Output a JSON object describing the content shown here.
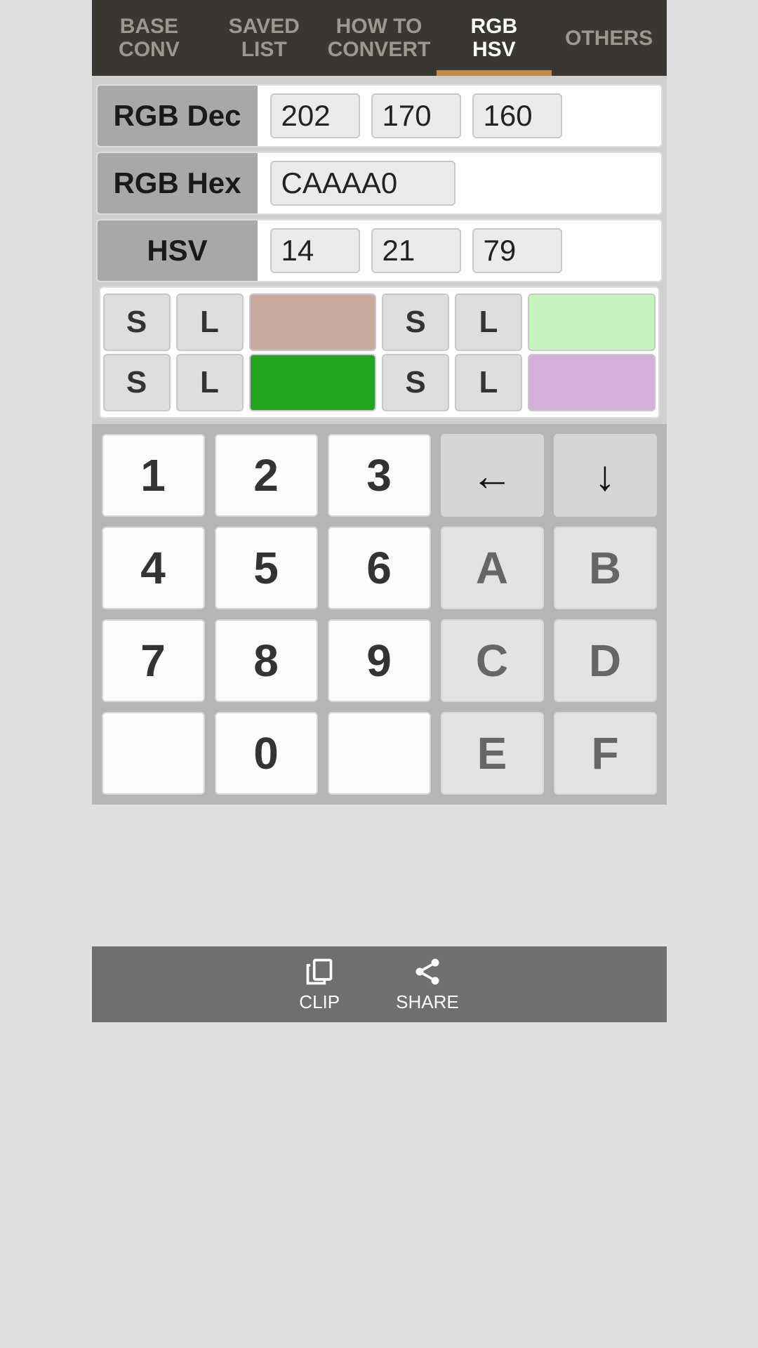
{
  "tabs": [
    {
      "label": "BASE\nCONV"
    },
    {
      "label": "SAVED\nLIST"
    },
    {
      "label": "HOW TO\nCONVERT"
    },
    {
      "label": "RGB\nHSV"
    },
    {
      "label": "OTHERS"
    }
  ],
  "rows": {
    "rgbDec": {
      "label": "RGB Dec",
      "r": "202",
      "g": "170",
      "b": "160"
    },
    "rgbHex": {
      "label": "RGB Hex",
      "value": "CAAAA0"
    },
    "hsv": {
      "label": "HSV",
      "h": "14",
      "s": "21",
      "v": "79"
    }
  },
  "swatches": {
    "row1": {
      "colorA": "#caaaa0",
      "colorB": "#c4f5bc"
    },
    "row2": {
      "colorA": "#21a521",
      "colorB": "#d3b0d7"
    }
  },
  "sl": {
    "s": "S",
    "l": "L"
  },
  "keypad": {
    "k1": "1",
    "k2": "2",
    "k3": "3",
    "back": "←",
    "down": "↓",
    "k4": "4",
    "k5": "5",
    "k6": "6",
    "kA": "A",
    "kB": "B",
    "k7": "7",
    "k8": "8",
    "k9": "9",
    "kC": "C",
    "kD": "D",
    "blank1": "",
    "k0": "0",
    "blank2": "",
    "kE": "E",
    "kF": "F"
  },
  "bottom": {
    "clip": "CLIP",
    "share": "SHARE"
  }
}
